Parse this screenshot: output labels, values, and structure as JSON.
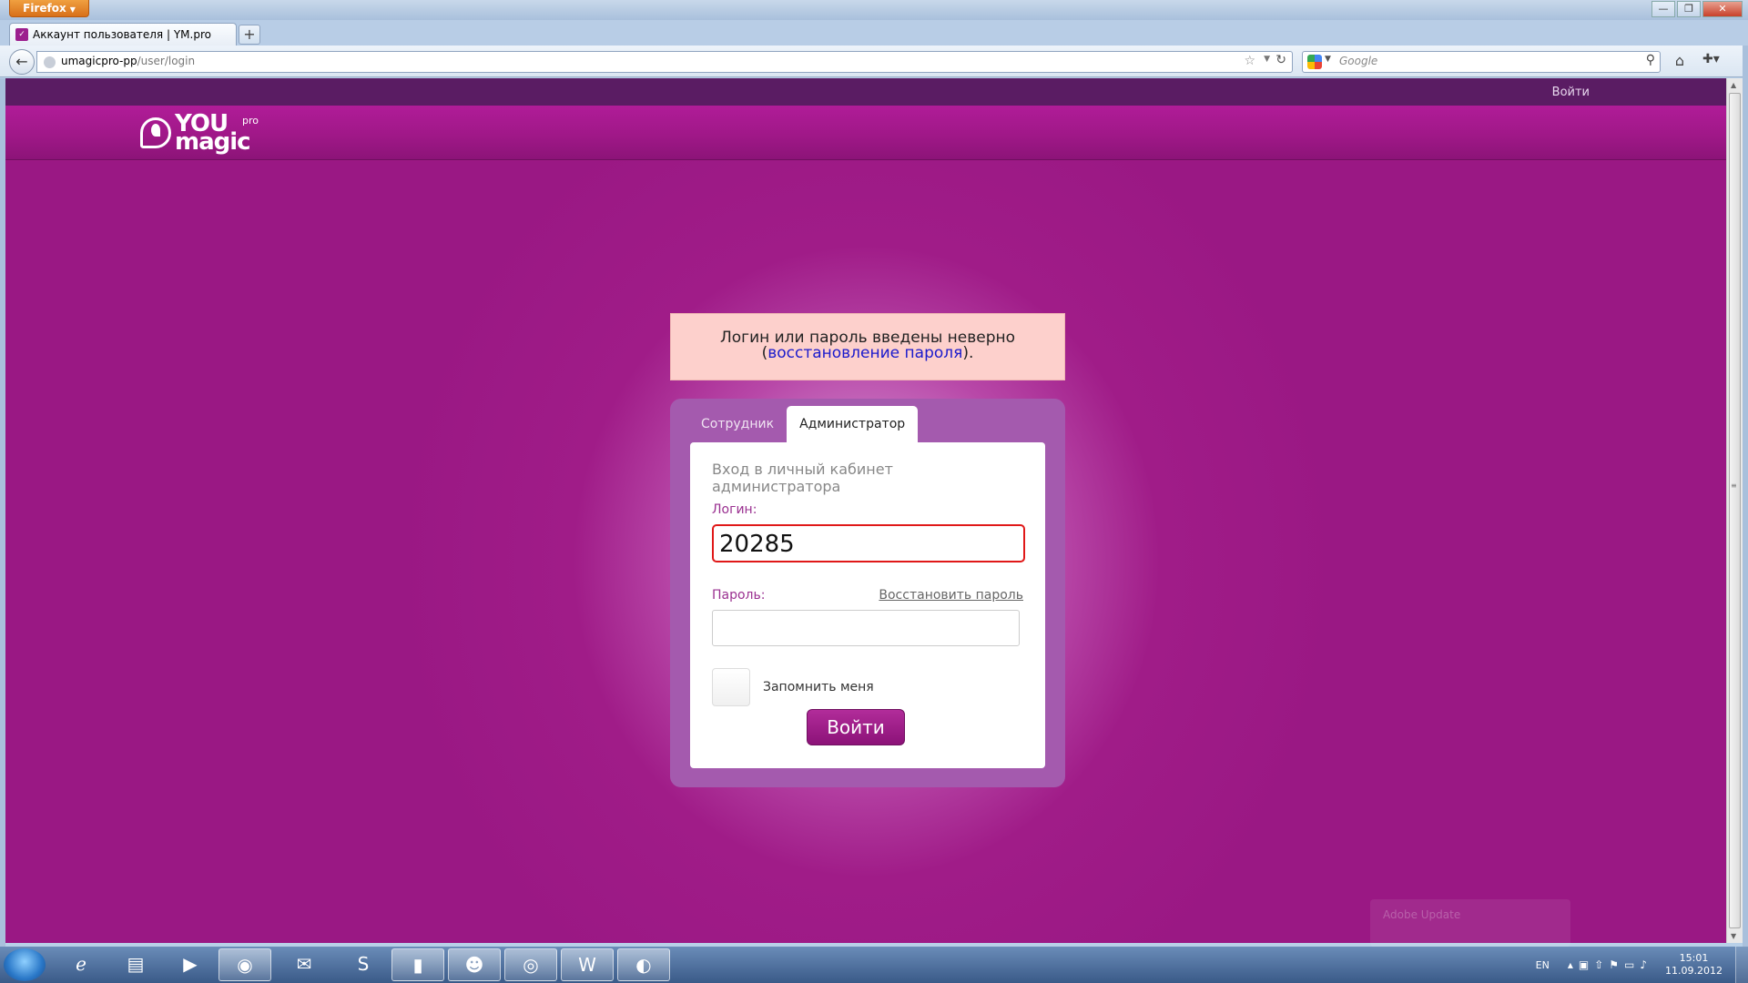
{
  "browser": {
    "menu_button": "Firefox",
    "tab_title": "Аккаунт пользователя | YM.pro",
    "url_host": "umagicpro-pp",
    "url_path": "/user/login",
    "search_placeholder": "Google"
  },
  "site": {
    "top_login_link": "Войти",
    "logo_you": "YOU",
    "logo_magic": "magic",
    "logo_pro": "pro"
  },
  "error": {
    "line1": "Логин или пароль введены неверно",
    "open_paren": "(",
    "restore_link": "восстановление пароля",
    "close_paren": ")."
  },
  "login": {
    "tab_employee": "Сотрудник",
    "tab_admin": "Администратор",
    "heading": "Вход в личный кабинет администратора",
    "login_label": "Логин:",
    "login_value": "20285",
    "password_label": "Пароль:",
    "restore_password": "Восстановить пароль",
    "remember_label": "Запомнить меня",
    "submit_label": "Войти"
  },
  "taskbar": {
    "language": "EN",
    "time": "15:01",
    "date": "11.09.2012",
    "notification": "Adobe Update"
  },
  "colors": {
    "brand_purple": "#9e1a86",
    "error_bg": "#fdd0cc",
    "input_error_border": "#e01818",
    "link_blue": "#1a1acc"
  }
}
